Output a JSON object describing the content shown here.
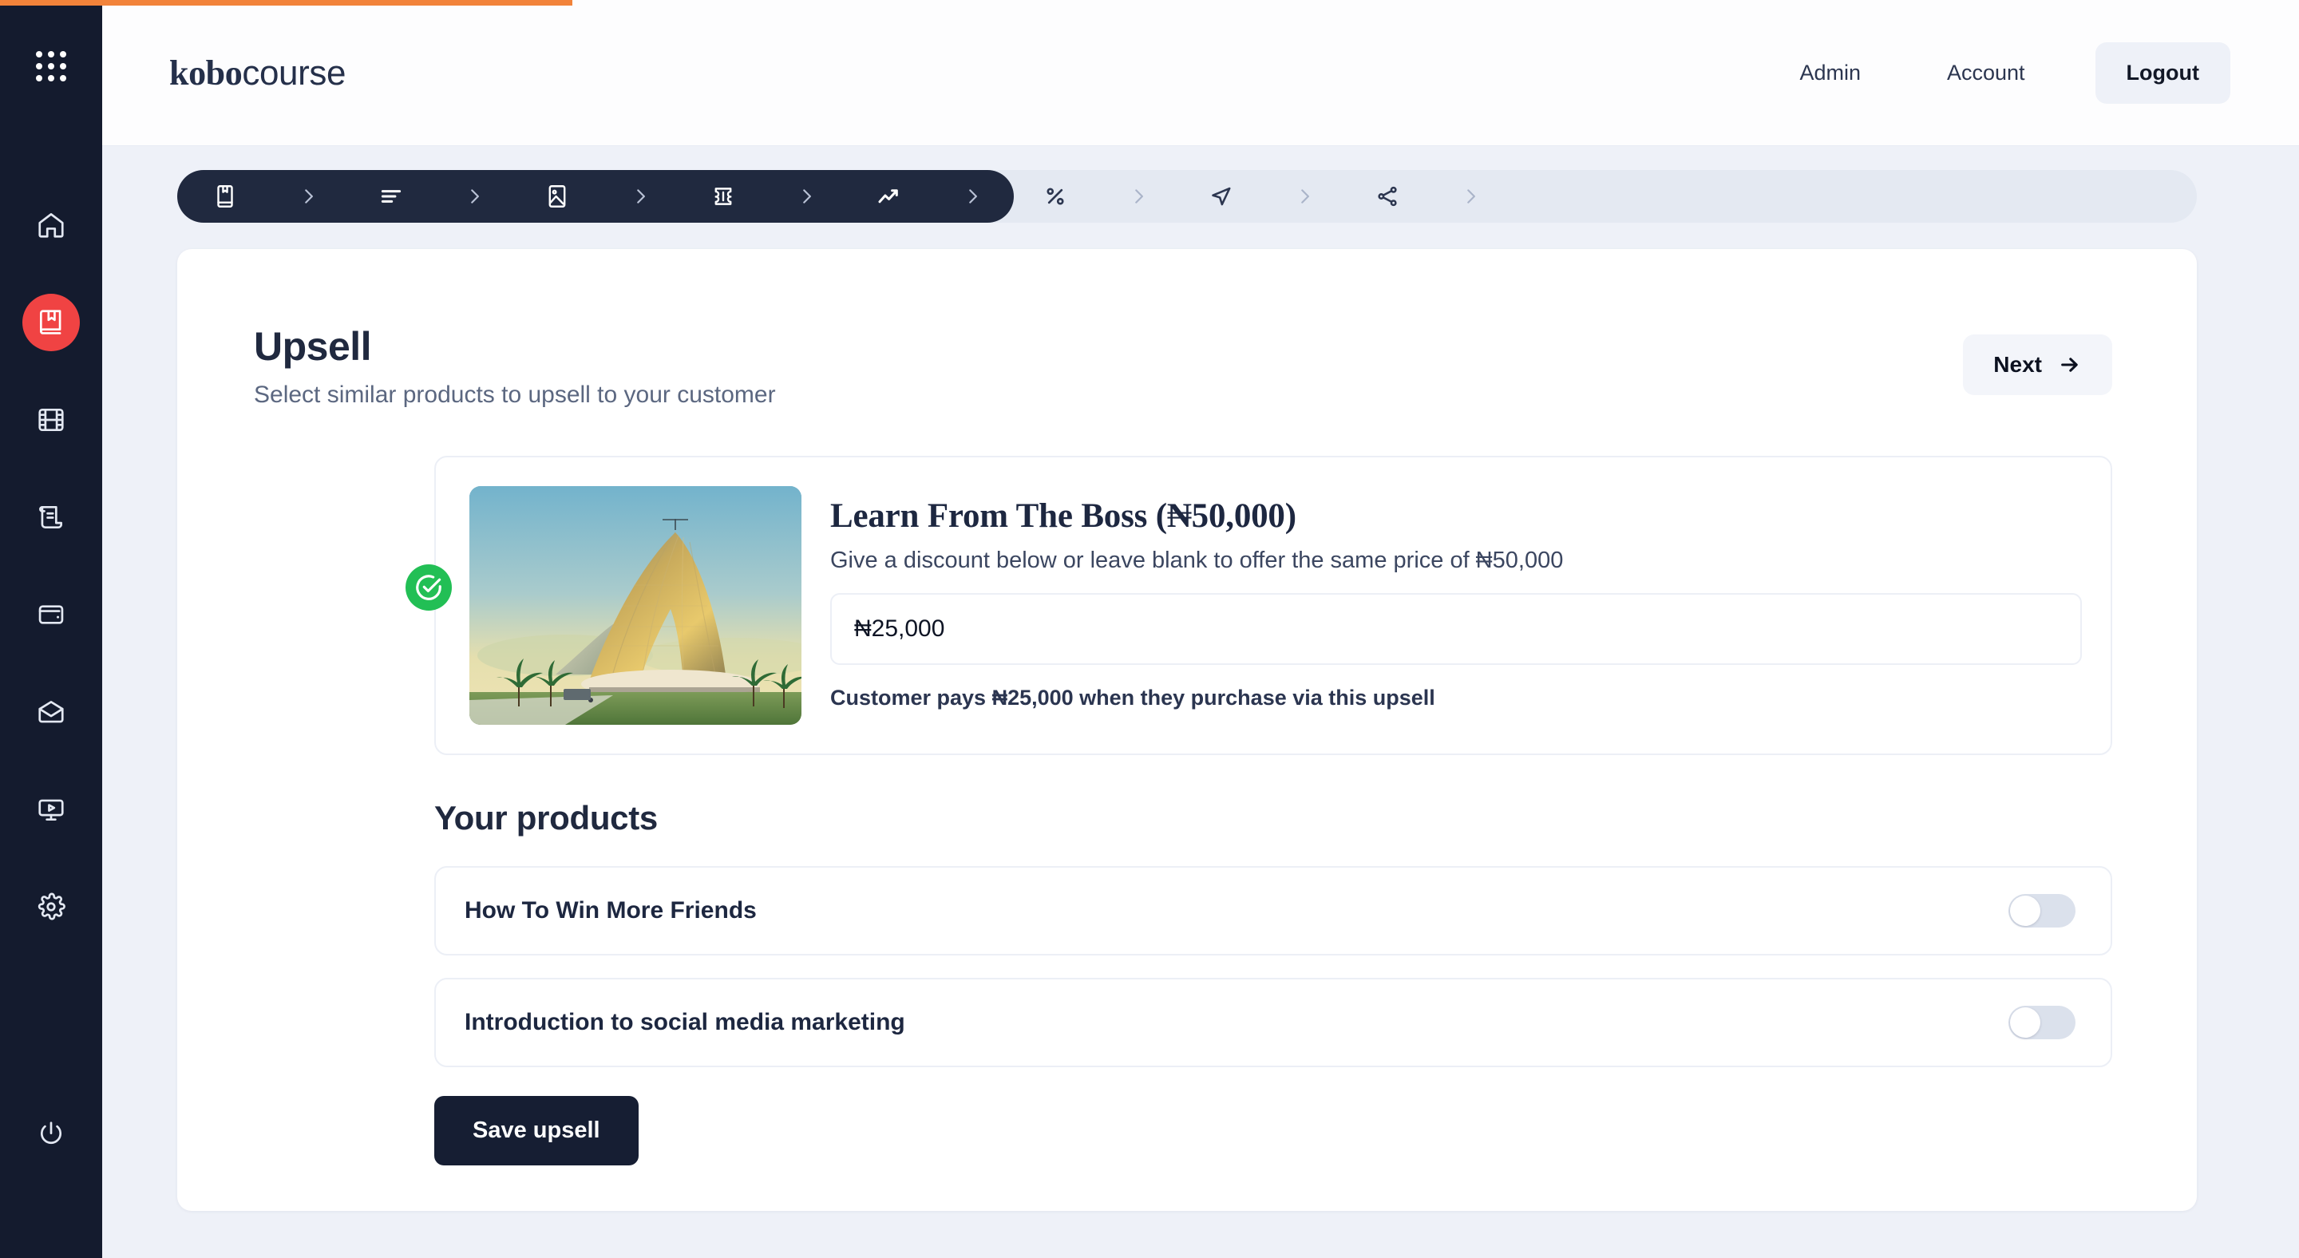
{
  "theme": {
    "accent_orange": "#f2833a",
    "sidebar_bg": "#141b2e",
    "active_red": "#f04343",
    "success_green": "#22bf55",
    "page_bg": "#eef1f8",
    "dark_button": "#161e33"
  },
  "sidebar": {
    "apps_icon": "apps-grid-icon",
    "items": [
      {
        "icon": "home-icon",
        "name": "home",
        "active": false
      },
      {
        "icon": "book-icon",
        "name": "courses",
        "active": true
      },
      {
        "icon": "film-icon",
        "name": "media",
        "active": false
      },
      {
        "icon": "scroll-icon",
        "name": "orders",
        "active": false
      },
      {
        "icon": "wallet-icon",
        "name": "wallet",
        "active": false
      },
      {
        "icon": "envelope-icon",
        "name": "messages",
        "active": false
      },
      {
        "icon": "monitor-play-icon",
        "name": "webinars",
        "active": false
      },
      {
        "icon": "gear-icon",
        "name": "settings",
        "active": false
      }
    ],
    "power_icon": "power-icon"
  },
  "header": {
    "brand_bold": "kobo",
    "brand_light": "course",
    "links": [
      {
        "label": "Admin"
      },
      {
        "label": "Account"
      }
    ],
    "logout_label": "Logout"
  },
  "steps": {
    "completed": [
      {
        "icon": "book-bookmark-icon",
        "name": "step-details"
      },
      {
        "icon": "align-lines-icon",
        "name": "step-description"
      },
      {
        "icon": "image-icon",
        "name": "step-cover"
      },
      {
        "icon": "ticket-icon",
        "name": "step-pricing"
      },
      {
        "icon": "trending-up-icon",
        "name": "step-upsell"
      }
    ],
    "upcoming": [
      {
        "icon": "percent-icon",
        "name": "step-discount"
      },
      {
        "icon": "send-icon",
        "name": "step-publish"
      },
      {
        "icon": "share-icon",
        "name": "step-share"
      }
    ],
    "separator_icon": "chevron-right-icon"
  },
  "main": {
    "title": "Upsell",
    "subtitle": "Select similar products to upsell to your customer",
    "next_label": "Next",
    "next_icon": "arrow-right-icon"
  },
  "upsell": {
    "selected_icon": "check-circle-icon",
    "thumbnail_name": "product-thumbnail",
    "title": "Learn From The Boss (₦50,000)",
    "description": "Give a discount below or leave blank to offer the same price of ₦50,000",
    "discount_value": "₦25,000",
    "discount_placeholder": "₦25,000",
    "note": "Customer pays ₦25,000 when they purchase via this upsell"
  },
  "products": {
    "heading": "Your products",
    "items": [
      {
        "name": "How To Win More Friends",
        "enabled": false
      },
      {
        "name": "Introduction to social media marketing",
        "enabled": false
      }
    ],
    "save_label": "Save upsell"
  }
}
